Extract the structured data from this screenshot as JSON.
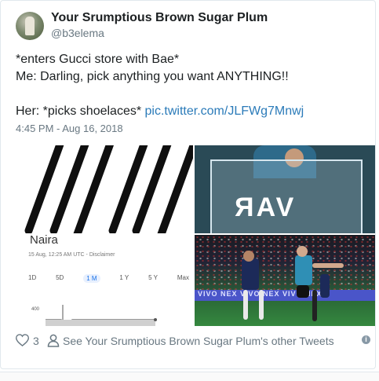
{
  "user": {
    "name": "Your Srumptious Brown Sugar Plum",
    "handle": "@b3elema"
  },
  "tweet": {
    "lines": [
      "*enters Gucci store with Bae*",
      "Me: Darling, pick anything you want ANYTHING!!",
      "",
      "Her: *picks shoelaces* "
    ],
    "link": "pic.twitter.com/JLFWg7Mnwj",
    "timestamp": "4:45 PM - Aug 16, 2018"
  },
  "media": {
    "var_label": "VAR",
    "naira": {
      "title": "Naira",
      "subtitle": "15 Aug, 12:25 AM UTC - Disclaimer",
      "ranges": [
        "1D",
        "5D",
        "1 M",
        "1 Y",
        "5 Y",
        "Max"
      ],
      "selected_range": "1 M",
      "axis_label": "400"
    },
    "banner": "VIVO NEX   VIVO NEX   VIVO NEX"
  },
  "actions": {
    "likes": "3",
    "other_tweets": "See Your Srumptious Brown Sugar Plum's other Tweets",
    "info": "i"
  },
  "colors": {
    "link": "#2b7bb9",
    "muted": "#697882"
  }
}
